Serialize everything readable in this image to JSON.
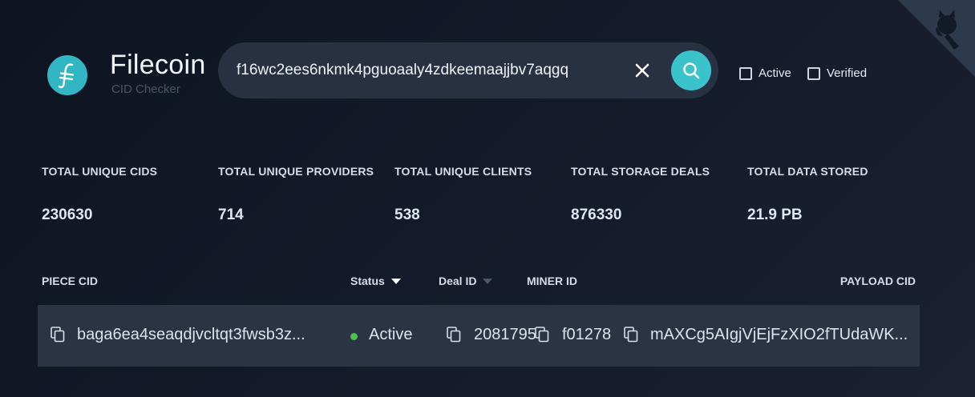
{
  "brand": {
    "name": "Filecoin",
    "subtitle": "CID Checker",
    "logo_icon": "filecoin-logo-icon",
    "accent": "#3bc3cc"
  },
  "search": {
    "value": "f16wc2ees6nkmk4pguoaaly4zdkeemaajjbv7aqgq",
    "clear_icon": "close-icon",
    "submit_icon": "search-icon"
  },
  "filters": [
    {
      "label": "Active",
      "checked": false
    },
    {
      "label": "Verified",
      "checked": false
    }
  ],
  "corner_icon": "github-icon",
  "stats": [
    {
      "label": "TOTAL UNIQUE CIDS",
      "value": "230630"
    },
    {
      "label": "TOTAL UNIQUE PROVIDERS",
      "value": "714"
    },
    {
      "label": "TOTAL UNIQUE CLIENTS",
      "value": "538"
    },
    {
      "label": "TOTAL STORAGE DEALS",
      "value": "876330"
    },
    {
      "label": "TOTAL DATA STORED",
      "value": "21.9 PB"
    }
  ],
  "table": {
    "columns": {
      "piece_cid": "PIECE CID",
      "status": "Status",
      "deal_id": "Deal ID",
      "miner_id": "MINER ID",
      "payload_cid": "PAYLOAD CID"
    },
    "rows": [
      {
        "piece_cid": "baga6ea4seaqdjvcltqt3fwsb3z...",
        "status": "Active",
        "status_color": "#4cc24c",
        "deal_id": "2081795",
        "miner_id": "f01278",
        "payload_cid": "mAXCg5AIgjVjEjFzXIO2fTUdaWK..."
      }
    ]
  }
}
